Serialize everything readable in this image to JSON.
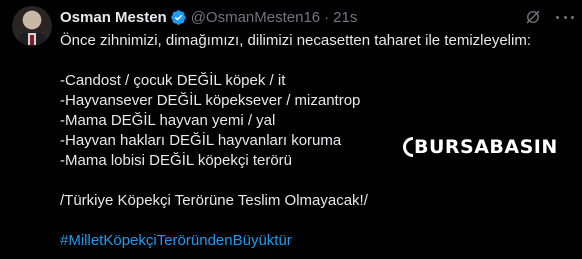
{
  "post": {
    "author": {
      "display_name": "Osman Mesten",
      "handle": "@OsmanMesten16",
      "separator": "·",
      "time": "21s"
    },
    "lines": [
      "Önce zihnimizi, dimağımızı, dilimizi necasetten taharet ile temizleyelim:",
      "-Candost / çocuk DEĞİL köpek / it",
      "-Hayvansever DEĞİL köpeksever / mizantrop",
      "-Mama DEĞİL hayvan yemi / yal",
      "-Hayvan hakları DEĞİL hayvanları koruma",
      "-Mama lobisi DEĞİL köpekçi terörü",
      "/Türkiye Köpekçi Terörüne Teslim Olmayacak!/",
      "#MilletKöpekçiTeröründenBüyüktür"
    ],
    "watermark": "BURSABASIN",
    "icons": {
      "verified": "verified-badge-icon",
      "grok": "grok-icon",
      "more": "more-options-icon"
    },
    "colors": {
      "background": "#000000",
      "text": "#e7e9ea",
      "secondary": "#71767b",
      "accent": "#1d9bf0"
    }
  }
}
